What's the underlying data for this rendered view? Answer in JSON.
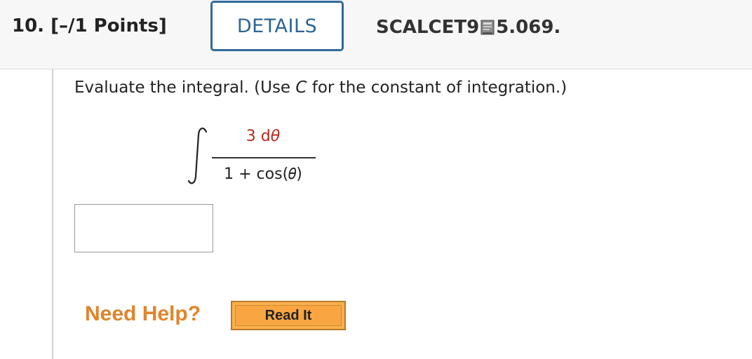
{
  "header": {
    "question_label": "10.  [–/1 Points]",
    "details_label": "DETAILS",
    "problem_id_prefix": "SCALCET9 ",
    "problem_id_suffix": "5.069.",
    "problem_id_icon": "book-reference-icon"
  },
  "question": {
    "prompt_before": "Evaluate the integral. (Use ",
    "prompt_var": "C",
    "prompt_after": " for the constant of integration.)",
    "integral": {
      "numerator_coef": "3 d",
      "numerator_var": "θ",
      "denominator": "1 + cos(𝜃)"
    },
    "answer_value": ""
  },
  "help": {
    "need_help_label": "Need Help?",
    "read_it_label": "Read It"
  },
  "colors": {
    "details_border": "#2f6b9a",
    "numerator_red": "#b22a1f",
    "need_help_orange": "#e0842b",
    "read_it_fill": "#f9a642"
  }
}
